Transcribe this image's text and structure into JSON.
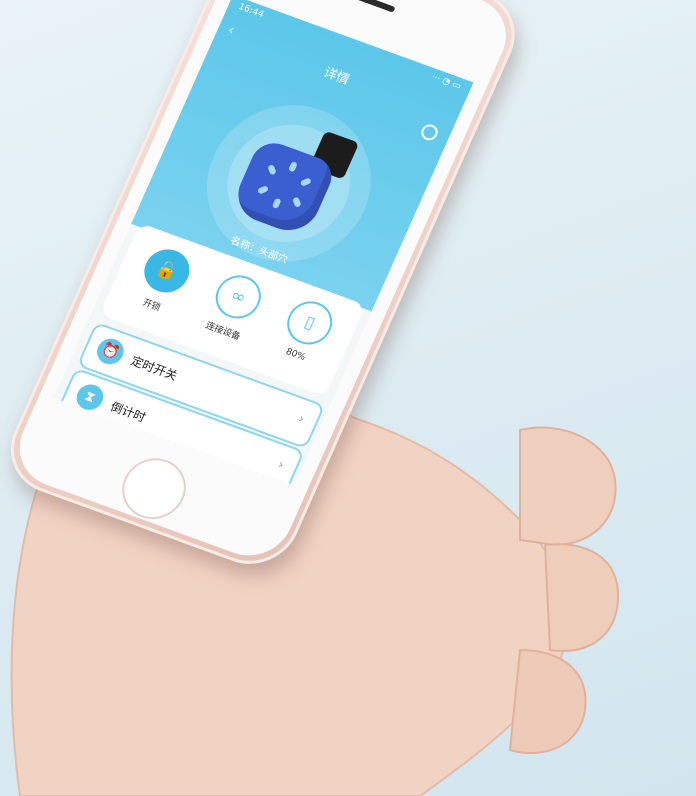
{
  "status": {
    "time": "16:44",
    "indicators": "··· ◔ ▭"
  },
  "header": {
    "back_icon": "back-arrow-icon",
    "title": "详情",
    "settings_icon": "gear-icon"
  },
  "device": {
    "name": "名称：头部穴"
  },
  "quick_actions": [
    {
      "icon": "lock-icon",
      "glyph": "🔓",
      "label": "开锁"
    },
    {
      "icon": "link-icon",
      "glyph": "∞",
      "label": "连接设备"
    },
    {
      "icon": "battery-icon",
      "glyph": "▯",
      "label": "80%"
    }
  ],
  "rows": [
    {
      "icon": "alarm-clock-icon",
      "glyph": "⏰",
      "label": "定时开关",
      "chevron": "›"
    },
    {
      "icon": "hourglass-icon",
      "glyph": "⧗",
      "label": "倒计时",
      "chevron": "›"
    }
  ],
  "colors": {
    "accent": "#39b8e6",
    "hero": "#5cc7ea",
    "device_blue": "#3b5ed0",
    "phone_body": "#efd2c8"
  }
}
